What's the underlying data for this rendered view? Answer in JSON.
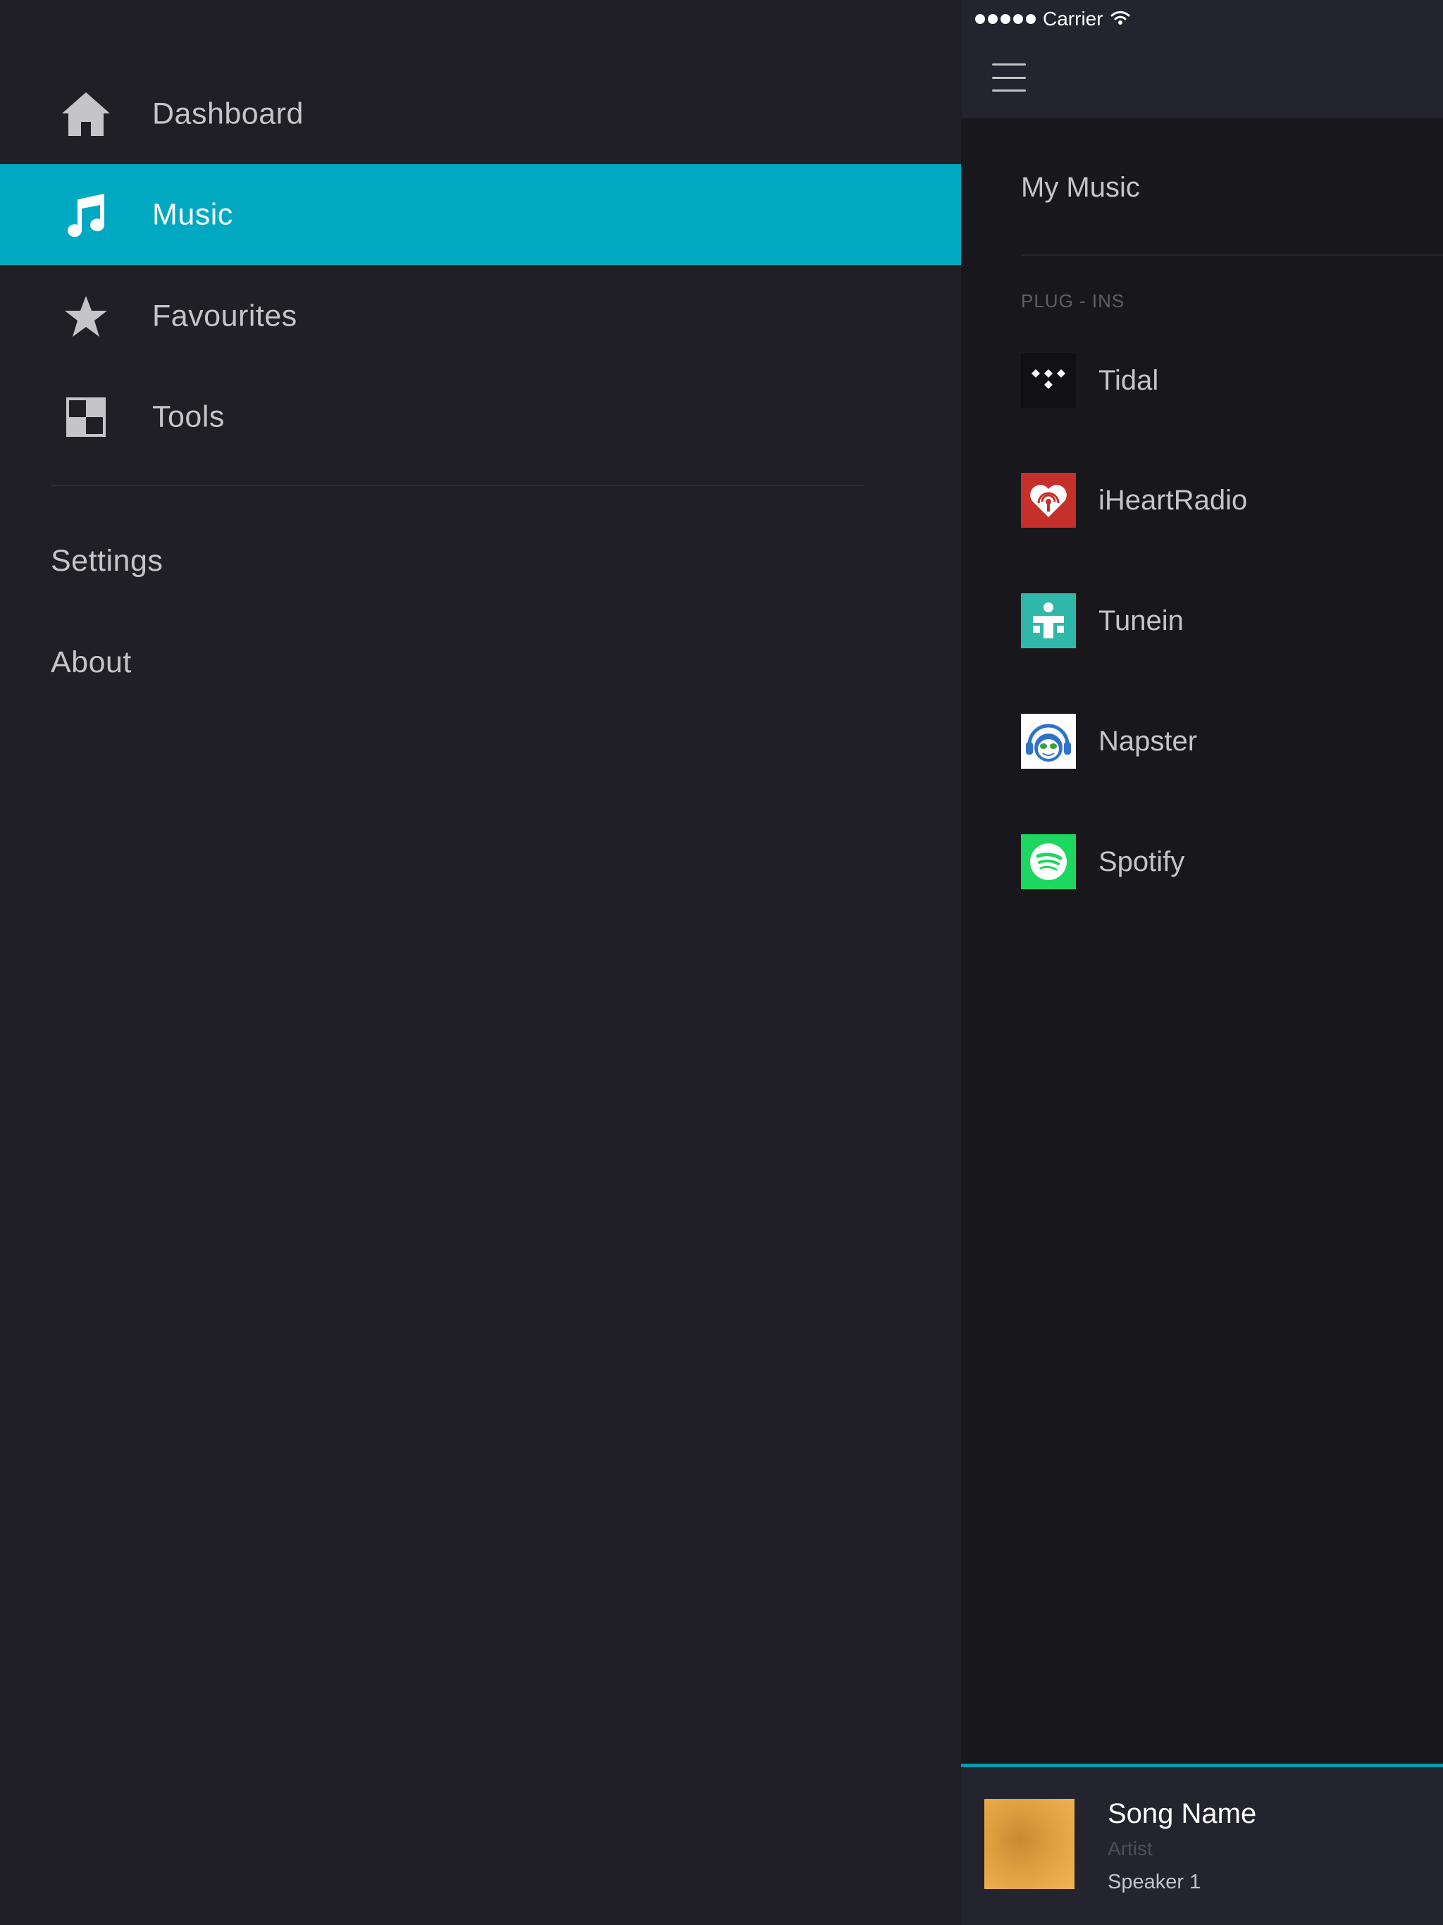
{
  "status_bar": {
    "carrier": "Carrier",
    "signal_icon": "signal-dots-icon",
    "wifi_icon": "wifi-icon"
  },
  "drawer": {
    "nav_items": [
      {
        "label": "Dashboard",
        "icon": "home-icon",
        "active": false
      },
      {
        "label": "Music",
        "icon": "music-note-icon",
        "active": true
      },
      {
        "label": "Favourites",
        "icon": "star-icon",
        "active": false
      },
      {
        "label": "Tools",
        "icon": "tools-grid-icon",
        "active": false
      }
    ],
    "links": [
      {
        "label": "Settings"
      },
      {
        "label": "About"
      }
    ],
    "active_color": "#00a8c1",
    "background_color": "#1f1f25"
  },
  "main": {
    "menu_icon": "hamburger-menu-icon",
    "my_music_label": "My Music",
    "plugins_header": "PLUG - INS",
    "plugins": [
      {
        "name": "Tidal",
        "icon": "tidal-logo-icon",
        "color": "#111114"
      },
      {
        "name": "iHeartRadio",
        "icon": "iheartradio-logo-icon",
        "color": "#c6302b"
      },
      {
        "name": "Tunein",
        "icon": "tunein-logo-icon",
        "color": "#2fb7aa"
      },
      {
        "name": "Napster",
        "icon": "napster-logo-icon",
        "color": "#ffffff"
      },
      {
        "name": "Spotify",
        "icon": "spotify-logo-icon",
        "color": "#1ed760"
      }
    ]
  },
  "now_playing": {
    "song": "Song Name",
    "artist": "Artist",
    "speaker": "Speaker 1",
    "accent_color": "#009aad"
  }
}
